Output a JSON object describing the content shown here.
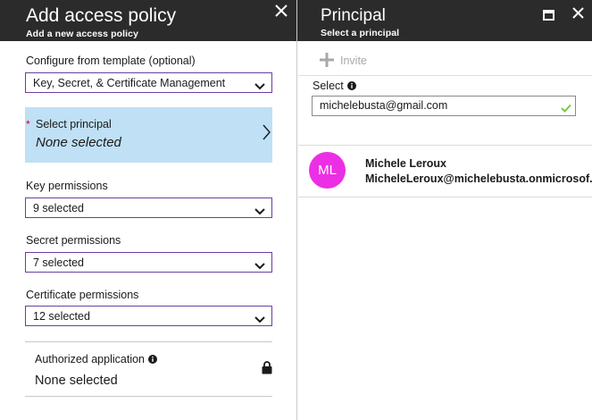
{
  "left_blade": {
    "title": "Add access policy",
    "subtitle": "Add a new access policy",
    "template": {
      "label": "Configure from template (optional)",
      "value": "Key, Secret, & Certificate Management"
    },
    "principal": {
      "required_mark": "*",
      "label": "Select principal",
      "value": "None selected"
    },
    "key_permissions": {
      "label": "Key permissions",
      "value": "9 selected"
    },
    "secret_permissions": {
      "label": "Secret permissions",
      "value": "7 selected"
    },
    "certificate_permissions": {
      "label": "Certificate permissions",
      "value": "12 selected"
    },
    "authorized_application": {
      "label": "Authorized application",
      "value": "None selected"
    }
  },
  "right_blade": {
    "title": "Principal",
    "subtitle": "Select a principal",
    "invite_label": "Invite",
    "select": {
      "label": "Select",
      "value": "michelebusta@gmail.com"
    },
    "results": [
      {
        "initials": "ML",
        "name": "Michele Leroux",
        "email": "MicheleLeroux@michelebusta.onmicrosof..."
      }
    ]
  },
  "colors": {
    "header_bg": "#2b2b2b",
    "dropdown_border": "#6b3fa0",
    "principal_tile_bg": "#bfe0f5",
    "avatar_bg": "#ec2fe4",
    "required": "#d0021b",
    "check": "#7ac943"
  },
  "icons": {
    "close": "close-icon",
    "maximize": "maximize-icon",
    "chevron_down": "chevron-down-icon",
    "chevron_right": "chevron-right-icon",
    "info": "info-icon",
    "lock": "lock-icon",
    "plus": "plus-icon",
    "check": "check-icon"
  }
}
